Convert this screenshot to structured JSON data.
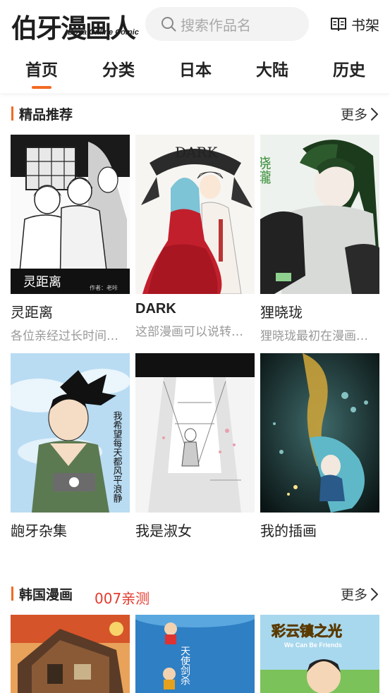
{
  "header": {
    "logo_main": "伯牙漫画人",
    "logo_sub": "Boya Online Comic",
    "search_placeholder": "搜索作品名",
    "shelf_label": "书架"
  },
  "nav": {
    "tabs": [
      {
        "label": "首页",
        "active": true
      },
      {
        "label": "分类",
        "active": false
      },
      {
        "label": "日本",
        "active": false
      },
      {
        "label": "大陆",
        "active": false
      },
      {
        "label": "历史",
        "active": false
      }
    ]
  },
  "sections": [
    {
      "title": "精品推荐",
      "note": "",
      "more_label": "更多",
      "items": [
        {
          "title": "灵距离",
          "desc": "各位亲经过长时间的等待…",
          "cover_caption": "灵距离",
          "cover_author": "作者：老咔"
        },
        {
          "title": "DARK",
          "desc": "这部漫画可以说转载的…",
          "cover_caption": "DARK"
        },
        {
          "title": "狸晓珑",
          "desc": "狸晓珑最初在漫画…",
          "cover_caption": "晓瓏"
        },
        {
          "title": "龅牙杂集",
          "desc": "",
          "cover_caption": "我希望每天都风平浪静"
        },
        {
          "title": "我是淑女",
          "desc": ""
        },
        {
          "title": "我的插画",
          "desc": ""
        }
      ]
    },
    {
      "title": "韩国漫画",
      "note": "007亲测",
      "more_label": "更多",
      "items": [
        {
          "title": "",
          "desc": ""
        },
        {
          "title": "",
          "desc": "",
          "cover_caption": "天使剑杀"
        },
        {
          "title": "",
          "desc": "",
          "cover_caption": "彩云镇之光",
          "cover_sub": "We Can Be Friends"
        }
      ]
    }
  ],
  "colors": {
    "accent": "#f26a22",
    "note_red": "#e33b2e",
    "text_gray": "#999999"
  },
  "icons": {
    "search": "search-icon",
    "shelf": "book-icon",
    "more": "chevron-right-icon"
  }
}
